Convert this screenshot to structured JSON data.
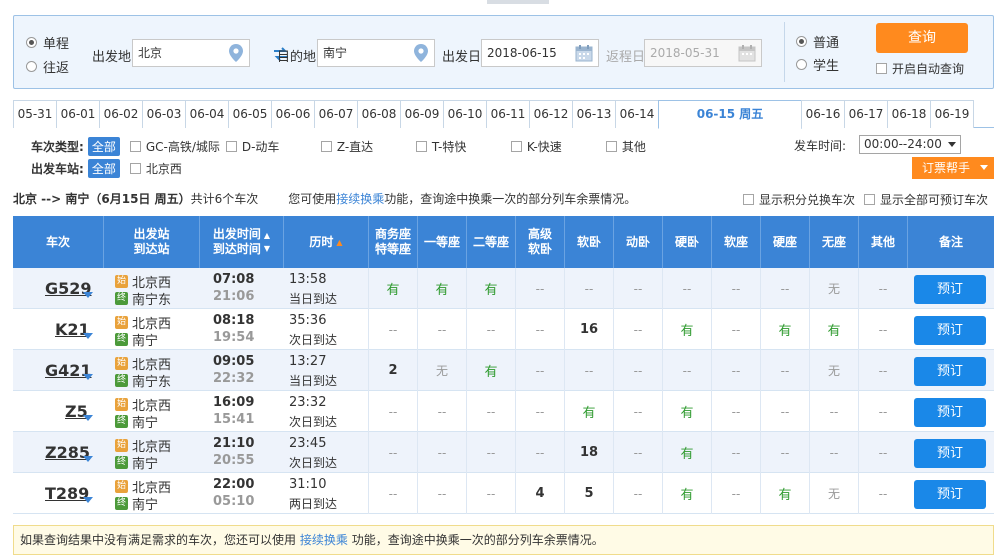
{
  "search": {
    "trip_types": [
      {
        "label": "单程",
        "selected": true
      },
      {
        "label": "往返",
        "selected": false
      }
    ],
    "from_label": "出发地",
    "from_value": "北京",
    "to_label": "目的地",
    "to_value": "南宁",
    "depart_label": "出发日",
    "depart_value": "2018-06-15",
    "return_label": "返程日",
    "return_value": "2018-05-31",
    "passenger_types": [
      {
        "label": "普通",
        "selected": true
      },
      {
        "label": "学生",
        "selected": false
      }
    ],
    "query_label": "查询",
    "auto_query_label": "开启自动查询"
  },
  "date_tabs": [
    "05-31",
    "06-01",
    "06-02",
    "06-03",
    "06-04",
    "06-05",
    "06-06",
    "06-07",
    "06-08",
    "06-09",
    "06-10",
    "06-11",
    "06-12",
    "06-13",
    "06-14",
    "06-15 周五",
    "06-16",
    "06-17",
    "06-18",
    "06-19"
  ],
  "active_date_index": 15,
  "filters": {
    "type_title": "车次类型:",
    "all_label": "全部",
    "types": [
      "GC-高铁/城际",
      "D-动车",
      "Z-直达",
      "T-特快",
      "K-快速",
      "其他"
    ],
    "station_title": "出发车站:",
    "stations": [
      "北京西"
    ],
    "time_label": "发车时间:",
    "time_value": "00:00--24:00",
    "helper_label": "订票帮手"
  },
  "summary": {
    "route": "北京 --> 南宁（6月15日  周五）",
    "count": "共计6个车次",
    "tip_pre": "您可使用",
    "tip_link": "接续换乘",
    "tip_post": "功能，查询途中换乘一次的部分列车余票情况。",
    "opt1": "显示积分兑换车次",
    "opt2": "显示全部可预订车次"
  },
  "table": {
    "headers": {
      "train": "车次",
      "station": [
        "出发站",
        "到达站"
      ],
      "time": [
        "出发时间",
        "到达时间"
      ],
      "duration": "历时",
      "seats": [
        [
          "商务座",
          "特等座"
        ],
        [
          "一等座"
        ],
        [
          "二等座"
        ],
        [
          "高级",
          "软卧"
        ],
        [
          "软卧"
        ],
        [
          "动卧"
        ],
        [
          "硬卧"
        ],
        [
          "软座"
        ],
        [
          "硬座"
        ],
        [
          "无座"
        ],
        [
          "其他"
        ]
      ],
      "remark": "备注"
    },
    "rows": [
      {
        "train": "G529",
        "from": "北京西",
        "to": "南宁东",
        "dep": "07:08",
        "arr": "21:06",
        "dur": "13:58",
        "day": "当日到达",
        "seats": [
          "有",
          "有",
          "有",
          "--",
          "--",
          "--",
          "--",
          "--",
          "--",
          "无",
          "--"
        ]
      },
      {
        "train": "K21",
        "from": "北京西",
        "to": "南宁",
        "dep": "08:18",
        "arr": "19:54",
        "dur": "35:36",
        "day": "次日到达",
        "seats": [
          "--",
          "--",
          "--",
          "--",
          "16",
          "--",
          "有",
          "--",
          "有",
          "有",
          "--"
        ]
      },
      {
        "train": "G421",
        "from": "北京西",
        "to": "南宁东",
        "dep": "09:05",
        "arr": "22:32",
        "dur": "13:27",
        "day": "当日到达",
        "seats": [
          "2",
          "无",
          "有",
          "--",
          "--",
          "--",
          "--",
          "--",
          "--",
          "无",
          "--"
        ]
      },
      {
        "train": "Z5",
        "from": "北京西",
        "to": "南宁",
        "dep": "16:09",
        "arr": "15:41",
        "dur": "23:32",
        "day": "次日到达",
        "seats": [
          "--",
          "--",
          "--",
          "--",
          "有",
          "--",
          "有",
          "--",
          "--",
          "--",
          "--"
        ]
      },
      {
        "train": "Z285",
        "from": "北京西",
        "to": "南宁",
        "dep": "21:10",
        "arr": "20:55",
        "dur": "23:45",
        "day": "次日到达",
        "seats": [
          "--",
          "--",
          "--",
          "--",
          "18",
          "--",
          "有",
          "--",
          "--",
          "--",
          "--"
        ]
      },
      {
        "train": "T289",
        "from": "北京西",
        "to": "南宁",
        "dep": "22:00",
        "arr": "05:10",
        "dur": "31:10",
        "day": "两日到达",
        "seats": [
          "--",
          "--",
          "--",
          "4",
          "5",
          "--",
          "有",
          "--",
          "有",
          "无",
          "--"
        ]
      }
    ],
    "book_label": "预订",
    "start_badge": "始",
    "end_badge": "终"
  },
  "footer": {
    "pre": "如果查询结果中没有满足需求的车次，您还可以使用",
    "link": "接续换乘",
    "post": " 功能，查询途中换乘一次的部分列车余票情况。"
  },
  "colors": {
    "accent": "#3b84d6",
    "orange": "#ff8a1e",
    "available": "#2e9a2e"
  }
}
